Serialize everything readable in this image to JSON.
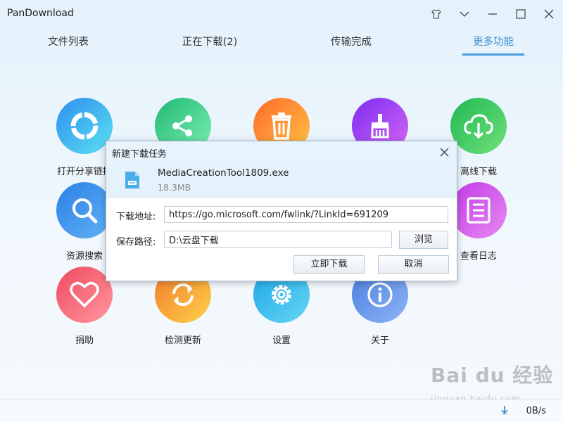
{
  "window": {
    "title": "PanDownload"
  },
  "tabs": [
    {
      "label": "文件列表",
      "active": false
    },
    {
      "label": "正在下载(2)",
      "active": false
    },
    {
      "label": "传输完成",
      "active": false
    },
    {
      "label": "更多功能",
      "active": true
    }
  ],
  "features": [
    {
      "label": "打开分享链接",
      "icon": "open-share-icon",
      "color_from": "#2d8ff0",
      "color_to": "#5ce0f0"
    },
    {
      "label": "",
      "icon": "share-icon",
      "color_from": "#1eb873",
      "color_to": "#7ff0b5"
    },
    {
      "label": "",
      "icon": "trash-icon",
      "color_from": "#ff6a2a",
      "color_to": "#ffc445"
    },
    {
      "label": "",
      "icon": "brush-icon",
      "color_from": "#7b2cf0",
      "color_to": "#d667f5"
    },
    {
      "label": "离线下载",
      "icon": "cloud-download-icon",
      "color_from": "#21b955",
      "color_to": "#6fe07a"
    },
    {
      "label": "资源搜索",
      "icon": "search-icon",
      "color_from": "#2a7fe6",
      "color_to": "#63b3f5"
    },
    {
      "label": "查看日志",
      "icon": "log-icon",
      "color_from": "#c13ae6",
      "color_to": "#e88af2"
    },
    {
      "label": "捐助",
      "icon": "heart-icon",
      "color_from": "#f0495d",
      "color_to": "#ff98a0"
    },
    {
      "label": "检测更新",
      "icon": "refresh-icon",
      "color_from": "#f07a2a",
      "color_to": "#ffd24a"
    },
    {
      "label": "设置",
      "icon": "gear-icon",
      "color_from": "#1aa7e6",
      "color_to": "#67d6f5"
    },
    {
      "label": "关于",
      "icon": "info-icon",
      "color_from": "#4a7fe0",
      "color_to": "#8db4f5"
    }
  ],
  "dialog": {
    "title": "新建下载任务",
    "file_name": "MediaCreationTool1809.exe",
    "file_size": "18.3MB",
    "url_label": "下载地址:",
    "url_value": "https://go.microsoft.com/fwlink/?LinkId=691209",
    "path_label": "保存路径:",
    "path_value": "D:\\云盘下载",
    "browse_label": "浏览",
    "download_label": "立即下载",
    "cancel_label": "取消"
  },
  "status": {
    "speed": "0B/s"
  },
  "watermark": {
    "main": "Bai du 经验",
    "sub": "jingyan.baidu.com"
  }
}
